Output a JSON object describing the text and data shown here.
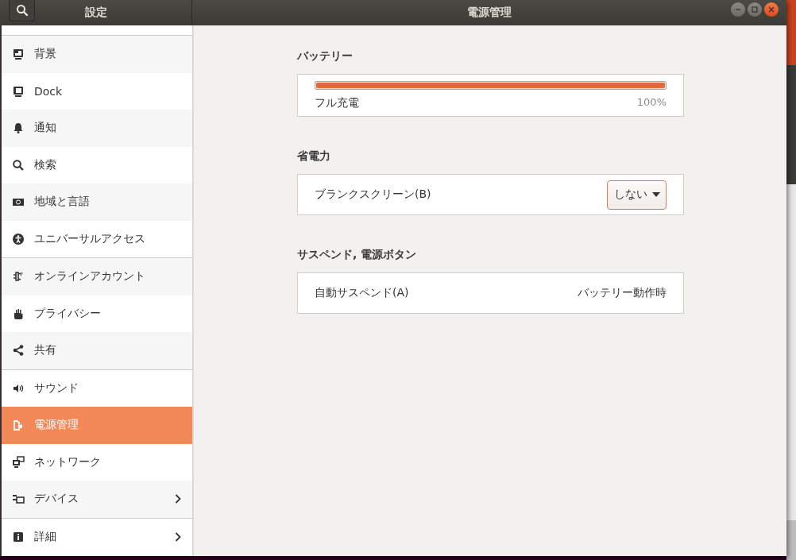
{
  "header": {
    "sidebar_title": "設定",
    "title": "電源管理"
  },
  "sidebar": {
    "groups": [
      [
        {
          "label": "背景",
          "selected": false,
          "submenu": false
        },
        {
          "label": "Dock",
          "selected": false,
          "submenu": false
        },
        {
          "label": "通知",
          "selected": false,
          "submenu": false
        },
        {
          "label": "検索",
          "selected": false,
          "submenu": false
        },
        {
          "label": "地域と言語",
          "selected": false,
          "submenu": false
        },
        {
          "label": "ユニバーサルアクセス",
          "selected": false,
          "submenu": false
        }
      ],
      [
        {
          "label": "オンラインアカウント",
          "selected": false,
          "submenu": false
        },
        {
          "label": "プライバシー",
          "selected": false,
          "submenu": false
        },
        {
          "label": "共有",
          "selected": false,
          "submenu": false
        }
      ],
      [
        {
          "label": "サウンド",
          "selected": false,
          "submenu": false
        },
        {
          "label": "電源管理",
          "selected": true,
          "submenu": false
        },
        {
          "label": "ネットワーク",
          "selected": false,
          "submenu": false
        },
        {
          "label": "デバイス",
          "selected": false,
          "submenu": true
        }
      ],
      [
        {
          "label": "詳細",
          "selected": false,
          "submenu": true
        }
      ]
    ]
  },
  "sections": [
    {
      "heading": "バッテリー",
      "rows": [
        {
          "kind": "battery",
          "label": "フル充電",
          "reading": "100%",
          "level": 1.0
        }
      ]
    },
    {
      "heading": "省電力",
      "rows": [
        {
          "kind": "dropdown",
          "label": "ブランクスクリーン(B)",
          "value": "しない"
        }
      ]
    },
    {
      "heading": "サスペンド, 電源ボタン",
      "rows": [
        {
          "kind": "value",
          "label": "自動サスペンド(A)",
          "value": "バッテリー動作時"
        }
      ]
    }
  ]
}
